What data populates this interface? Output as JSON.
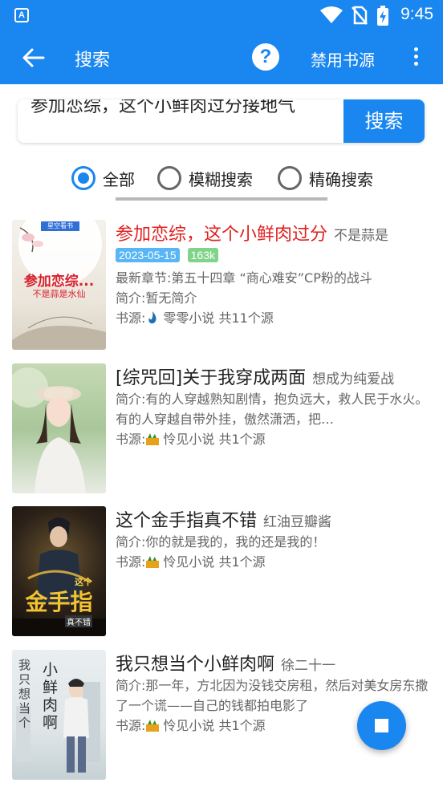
{
  "status": {
    "time": "9:45"
  },
  "toolbar": {
    "title": "搜索",
    "help_icon": "?",
    "disable_label": "禁用书源"
  },
  "search": {
    "query": "参加恋综，这个小鲜肉过分接地气",
    "button_label": "搜索"
  },
  "mode": {
    "options": [
      {
        "label": "全部",
        "selected": true
      },
      {
        "label": "模糊搜索",
        "selected": false
      },
      {
        "label": "精确搜索",
        "selected": false
      }
    ]
  },
  "results": [
    {
      "title": "参加恋综，这个小鲜肉过分",
      "author": "不是蒜是",
      "highlight": true,
      "tags": [
        "2023-05-15",
        "163k"
      ],
      "latest": "最新章节:第五十四章 “商心难安”CP粉的战斗",
      "desc": "简介:暂无简介",
      "source_prefix": "书源:",
      "source": "零零小说 共11个源",
      "cover_text_main": "参加恋综...",
      "cover_text_sub": "不是蒜是水仙",
      "cover_publisher": "星空看书"
    },
    {
      "title": "[综咒回]关于我穿成两面",
      "author": "想成为纯爱战",
      "highlight": false,
      "desc": "简介:有的人穿越熟知剧情，抱负远大，救人民于水火。有的人穿越自带外挂，傲然潇洒，把…",
      "source_prefix": "书源:",
      "source": "怜见小说 共1个源"
    },
    {
      "title": "这个金手指真不错",
      "author": "红油豆瓣酱",
      "highlight": false,
      "desc": "简介:你的就是我的，我的还是我的！",
      "source_prefix": "书源:",
      "source": "怜见小说 共1个源",
      "cover_text_main": "金手指",
      "cover_text_top": "这个",
      "cover_text_sub": "真不错"
    },
    {
      "title": "我只想当个小鲜肉啊",
      "author": "徐二十一",
      "highlight": false,
      "desc": "简介:那一年，方北因为没钱交房租，然后对美女房东撒了一个谎——自己的钱都拍电影了",
      "source_prefix": "书源:",
      "source": "怜见小说 共1个源",
      "cover_text_main": "小鲜肉啊",
      "cover_text_side": "我只想当个"
    }
  ],
  "colors": {
    "primary": "#1a86f0",
    "highlight": "#e02020",
    "tag_date": "#59b6f5",
    "tag_count": "#7fd48a"
  },
  "fab": {
    "icon": "stop-icon"
  }
}
